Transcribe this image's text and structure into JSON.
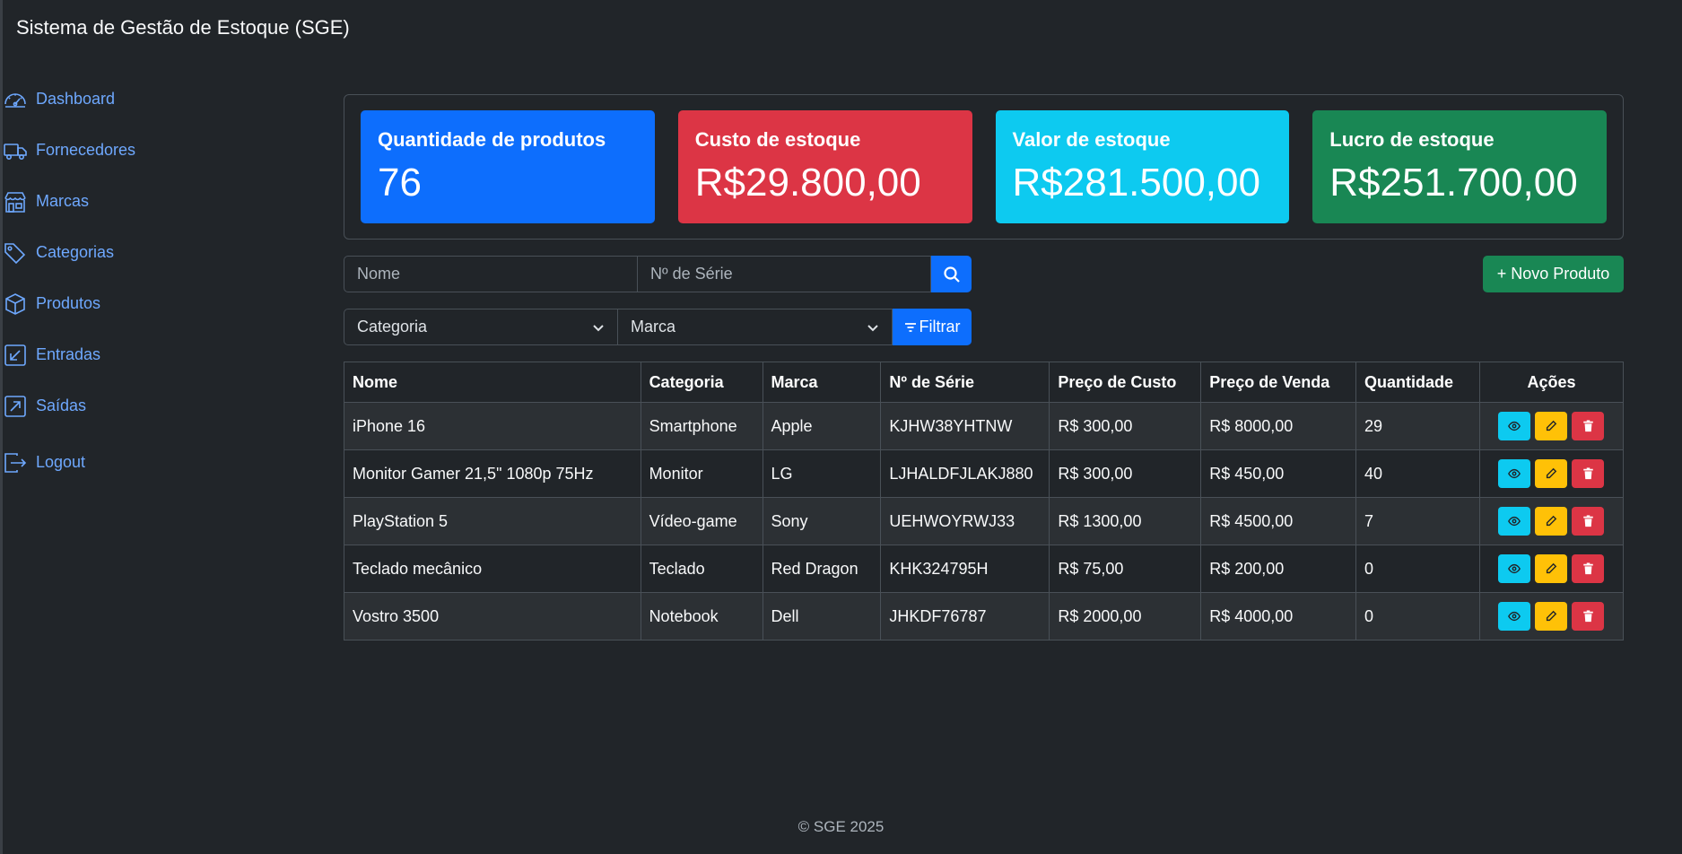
{
  "app": {
    "title": "Sistema de Gestão de Estoque (SGE)"
  },
  "nav": [
    {
      "label": "Dashboard",
      "icon": "speedometer-icon"
    },
    {
      "label": "Fornecedores",
      "icon": "truck-icon"
    },
    {
      "label": "Marcas",
      "icon": "shop-icon"
    },
    {
      "label": "Categorias",
      "icon": "tags-icon"
    },
    {
      "label": "Produtos",
      "icon": "box-icon"
    },
    {
      "label": "Entradas",
      "icon": "arrow-down-left-square-icon"
    },
    {
      "label": "Saídas",
      "icon": "arrow-up-right-square-icon"
    },
    {
      "label": "Logout",
      "icon": "logout-icon"
    }
  ],
  "stats": [
    {
      "title": "Quantidade de produtos",
      "value": "76",
      "color": "#0d6efd"
    },
    {
      "title": "Custo de estoque",
      "value": "R$29.800,00",
      "color": "#dc3545"
    },
    {
      "title": "Valor de estoque",
      "value": "R$281.500,00",
      "color": "#0dcaf0"
    },
    {
      "title": "Lucro de estoque",
      "value": "R$251.700,00",
      "color": "#198754"
    }
  ],
  "search": {
    "name_placeholder": "Nome",
    "serial_placeholder": "Nº de Série",
    "search_icon": "search-icon"
  },
  "new_product_label": "+ Novo Produto",
  "filters": {
    "category": "Categoria",
    "brand": "Marca",
    "filter_label": "Filtrar",
    "filter_icon": "filter-icon"
  },
  "table": {
    "headers": [
      "Nome",
      "Categoria",
      "Marca",
      "Nº de Série",
      "Preço de Custo",
      "Preço de Venda",
      "Quantidade",
      "Ações"
    ],
    "rows": [
      [
        "iPhone 16",
        "Smartphone",
        "Apple",
        "KJHW38YHTNW",
        "R$ 300,00",
        "R$ 8000,00",
        "29"
      ],
      [
        "Monitor Gamer 21,5\" 1080p 75Hz",
        "Monitor",
        "LG",
        "LJHALDFJLAKJ880",
        "R$ 300,00",
        "R$ 450,00",
        "40"
      ],
      [
        "PlayStation 5",
        "Vídeo-game",
        "Sony",
        "UEHWOYRWJ33",
        "R$ 1300,00",
        "R$ 4500,00",
        "7"
      ],
      [
        "Teclado mecânico",
        "Teclado",
        "Red Dragon",
        "KHK324795H",
        "R$ 75,00",
        "R$ 200,00",
        "0"
      ],
      [
        "Vostro 3500",
        "Notebook",
        "Dell",
        "JHKDF76787",
        "R$ 2000,00",
        "R$ 4000,00",
        "0"
      ]
    ]
  },
  "footer": "© SGE 2025"
}
